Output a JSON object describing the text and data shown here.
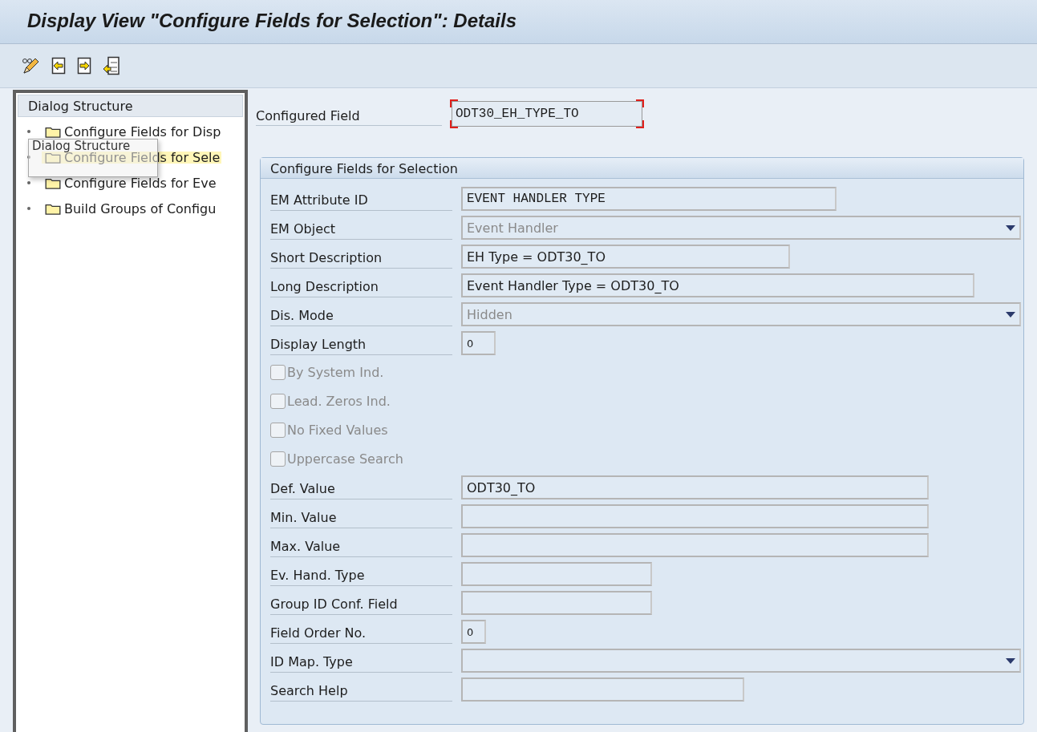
{
  "window": {
    "title": "Display View \"Configure Fields for Selection\": Details"
  },
  "toolbar": {
    "buttons": [
      {
        "kind": "edit"
      },
      {
        "kind": "previous"
      },
      {
        "kind": "next"
      },
      {
        "kind": "other"
      }
    ]
  },
  "sidebar": {
    "title": "Dialog Structure",
    "items": [
      {
        "label": "Configure Fields for Disp",
        "selected": false
      },
      {
        "label": "Configure Fields for Sele",
        "selected": true
      },
      {
        "label": "Configure Fields for Eve",
        "selected": false
      },
      {
        "label": "Build Groups of Configu",
        "selected": false
      }
    ],
    "tooltip": "Dialog Structure"
  },
  "configured_field": {
    "label": "Configured Field",
    "value": "ODT30_EH_TYPE_TO"
  },
  "group": {
    "title": "Configure Fields for Selection",
    "fields": [
      {
        "kind": "text",
        "label": "EM Attribute ID",
        "value": "EVENT HANDLER TYPE"
      },
      {
        "kind": "dropdown",
        "label": "EM Object",
        "value": "Event Handler",
        "disabled": true
      },
      {
        "kind": "text",
        "label": "Short Description",
        "value": "EH Type = ODT30_TO"
      },
      {
        "kind": "text",
        "label": "Long Description",
        "value": "Event Handler Type = ODT30_TO"
      },
      {
        "kind": "dropdown",
        "label": "Dis. Mode",
        "value": "Hidden",
        "disabled": true
      },
      {
        "kind": "text",
        "label": "Display Length",
        "value": "0"
      },
      {
        "kind": "checkbox",
        "label": "By System Ind.",
        "checked": false,
        "disabled": true
      },
      {
        "kind": "checkbox",
        "label": "Lead. Zeros Ind.",
        "checked": false,
        "disabled": true
      },
      {
        "kind": "checkbox",
        "label": "No Fixed Values",
        "checked": false,
        "disabled": true
      },
      {
        "kind": "checkbox",
        "label": "Uppercase Search",
        "checked": false,
        "disabled": true
      },
      {
        "kind": "text",
        "label": "Def. Value",
        "value": "ODT30_TO"
      },
      {
        "kind": "text",
        "label": "Min. Value"
      },
      {
        "kind": "text",
        "label": "Max. Value"
      },
      {
        "kind": "text",
        "label": "Ev. Hand. Type"
      },
      {
        "kind": "text",
        "label": "Group ID Conf. Field"
      },
      {
        "kind": "text",
        "label": "Field Order No.",
        "value": "0"
      },
      {
        "kind": "dropdown",
        "label": "ID Map. Type"
      },
      {
        "kind": "text",
        "label": "Search Help"
      }
    ]
  }
}
